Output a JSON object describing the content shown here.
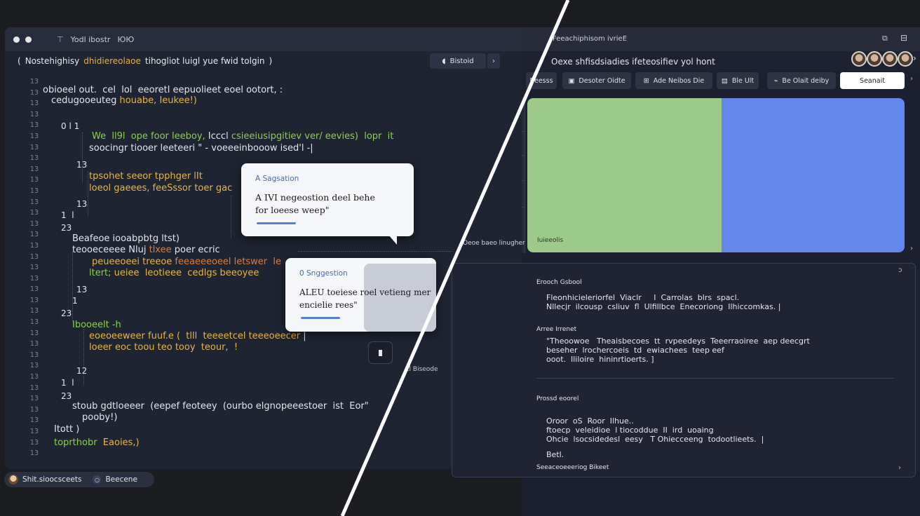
{
  "editor": {
    "tab_label": "Yodl ibostr",
    "tab_suffix": "ЮЮ",
    "search_prefix": "(",
    "search_text_a": "Nostehighisy",
    "search_text_hl": "dhidiereolaoe",
    "search_text_b": "tihogliot luigl yue fwid tolgin",
    "search_suffix": ")",
    "ai_pill_label": "Bistoid",
    "ai_pill_icon": "chat-bubble-icon",
    "next_label": "›",
    "line_numbers": [
      "13",
      "13",
      "13",
      "13",
      "13",
      "13",
      "13",
      "13",
      "13",
      "13",
      "13",
      "13",
      "13",
      "13",
      "13",
      "13",
      "13",
      "13",
      "13",
      "13",
      "13",
      "13",
      "13",
      "13",
      "13",
      "13",
      "13",
      "13",
      "13",
      "13",
      "13",
      "13",
      "13",
      "13",
      "13"
    ],
    "code": {
      "l1": "obioeel out.  cel  lol  eeoretl eepuolieet eoel ootort, :",
      "l2": "cedugooeuteg",
      "l2b": "houabe, Ieukee!)",
      "l3": "0 l 1",
      "l4a": "We  ll9l  ope foor leeboy,",
      "l4b": " Icccl",
      "l4c": " csieeiusipgitiev ver/ eevies)",
      "l4d": "  lopr  it",
      "l5a": "soocingr tiooer leeteeri",
      "l5b": " \" ",
      "l5c": "- voeeeinbooow ised'l",
      "l5d": " -|",
      "l6": "13",
      "l7": "tpsohet seeor tpphger lIt",
      "l8a": "loeol gaeees,",
      "l8b": " feeSssor toer gac",
      "l9": "13",
      "l10": "1  l",
      "l11": "23",
      "l12": "Beafeoe iooabpbtg ltst)",
      "l13a": "teooeceeee",
      "l13b": " Nluj",
      "l13c": " tlxee",
      "l13d": " poer ecric",
      "l14a": "peueeoeei treeoe",
      "l14b": " feeaeeeoeel letswer  le",
      "l15a": "ltert;",
      "l15b": " ueiee  leotieee  cedlgs beeoyee",
      "l16": "13",
      "l17": "1",
      "l18": "23",
      "l19": "Ibooeelt -h",
      "l20a": "eoeoeeweer",
      "l20b": " fuuf.e ",
      "l20c": "(  tlll  teeeetcel teeeoeecer",
      "l20d": " |",
      "l21": "loeer eoc toou teo tooy  teour,  !",
      "l22": "12",
      "l23": "1  l",
      "l24": "23",
      "l25": "stoub gdtloeeer  (eepef feoteey  (ourbo elgnopeeestoer  ist  Eor\"",
      "l26": "pooby!)",
      "l27": "Itott )",
      "l28a": "toprthobr",
      "l28b": "  Eaoies,)"
    },
    "suggestion_1": {
      "title": "A Sagsation",
      "body_1": "A IVI  negeostion deel behe",
      "body_2": "for loeese weep\""
    },
    "suggestion_2": {
      "title": "0 Snggestion",
      "body_1": "ALEU  toeiese  roel  vetieng mer",
      "body_2": "encielie rees\""
    },
    "small_label": "tl Biseode"
  },
  "status_bar": {
    "label_a": "Shit.sioocsceets",
    "label_b": "Beecene",
    "sep_icon": "circle-icon"
  },
  "right": {
    "title": "Feeachiphisom ivrieE",
    "title_icon": "copy-icon",
    "close_icon": "close-icon",
    "browser_query": "Oexe  shfisdsiadies ifeteosifiev yol  hont",
    "toolbar": [
      "Beesss",
      "Desoter Oidte",
      "Ade Neibos  Die",
      "Ble Ult",
      "Be Olait  deiby",
      "Seanait"
    ],
    "canvas_label": "Iuieeolis",
    "canvas_left_label": "Oeoe  baeo  linugher",
    "colors": {
      "green": "#9dc98a",
      "blue": "#6387e8"
    },
    "details": {
      "h1": "Erooch Gsbool",
      "t1a": "Fleonhicieleriorfel  Viaclr     I  Carrolas  blrs  spacl.",
      "t1b": "Nllecjr  ilcousp  csliuv  fl  Ulfillbce  Enecoriong  Ilhiccomkas. |",
      "h2": "Arree  Irrenet",
      "t2a": "\"Theoowoe   Theaisbecoes  tt  rvpeedeys  Teeerraoiree  aep deecgrt",
      "t2b": "beseher  lrochercoeis  td  ewiachees  teep eef",
      "t2c": "ooot.  Ililoire  hininrtioerts. ]",
      "h3": "Prossd  eoorel",
      "t3a": "Oroor  oS  Roor  Ilhue..",
      "t3b": "ftoecp  veleidioe  l tiocoddue  II  ird  uoaing",
      "t3c": "Ohcie  lsocsidedesl  eesy   T Ohiecceeng  todootlieets.  |",
      "t3d": "Betl.",
      "footer": "Seeaceoeeeriog  Bikeet"
    }
  }
}
